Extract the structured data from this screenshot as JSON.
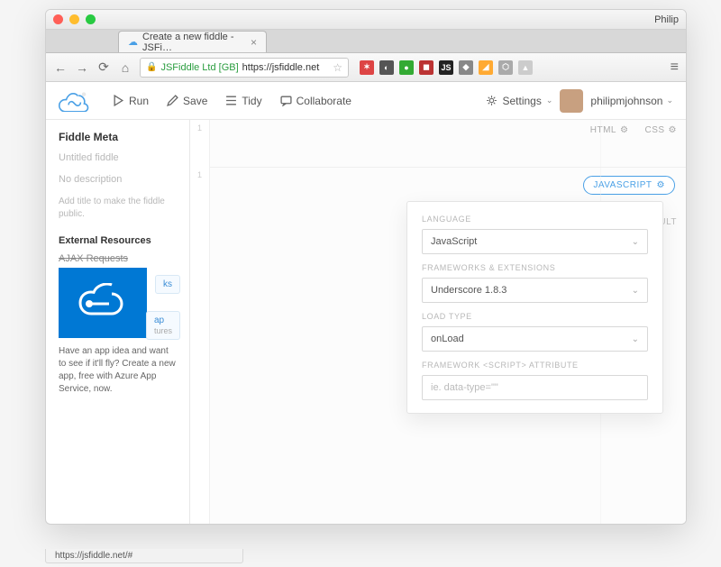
{
  "os": {
    "user": "Philip"
  },
  "browser": {
    "tab_title": "Create a new fiddle - JSFi…",
    "url_ssl_org": "JSFiddle Ltd [GB]",
    "url_rest": "https://jsfiddle.net",
    "status_url": "https://jsfiddle.net/#"
  },
  "toolbar": {
    "run": "Run",
    "save": "Save",
    "tidy": "Tidy",
    "collaborate": "Collaborate",
    "settings": "Settings",
    "username": "philipmjohnson"
  },
  "sidebar": {
    "meta_title": "Fiddle Meta",
    "title_placeholder": "Untitled fiddle",
    "desc_placeholder": "No description",
    "hint": "Add title to make the fiddle public.",
    "ext_title": "External Resources",
    "ajax": "AJAX Requests",
    "ks_label": "ks",
    "ap_label": "ap",
    "ap_sub": "tures",
    "azure_text": "Have an app idea and want to see if it'll fly? Create a new app, free with Azure App Service, now."
  },
  "panes": {
    "html": "HTML",
    "css": "CSS",
    "js": "JAVASCRIPT",
    "result": "RESULT"
  },
  "popup": {
    "lang_label": "LANGUAGE",
    "lang_value": "JavaScript",
    "fw_label": "FRAMEWORKS & EXTENSIONS",
    "fw_value": "Underscore 1.8.3",
    "load_label": "LOAD TYPE",
    "load_value": "onLoad",
    "attr_label": "FRAMEWORK <SCRIPT> ATTRIBUTE",
    "attr_placeholder": "ie. data-type=\"\""
  }
}
